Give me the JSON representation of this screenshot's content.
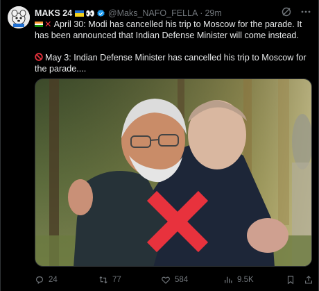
{
  "author": {
    "display_name": "MAKS 24",
    "handle": "@Maks_NAFO_FELLA",
    "separator": "·",
    "time": "29m",
    "eyes_emoji": "👀"
  },
  "icons": {
    "avatar": "avatar-icon",
    "flag": "ukraine-flag-icon",
    "verified": "verified-badge-icon",
    "grok": "grok-icon",
    "more": "more-icon"
  },
  "tweet": {
    "line1": "April 30: Modi has cancelled his trip to Moscow for the parade. It has been announced that Indian Defense Minister will come instead.",
    "line2": "May 3: Indian Defense Minister has cancelled his trip to Moscow for the parade...."
  },
  "actions": {
    "replies": "24",
    "reposts": "77",
    "likes": "584",
    "views": "9.5K"
  },
  "colors": {
    "background": "#000000",
    "text": "#e7e9ea",
    "muted": "#71767b",
    "verified": "#1d9bf0",
    "cross": "#e8323d"
  }
}
